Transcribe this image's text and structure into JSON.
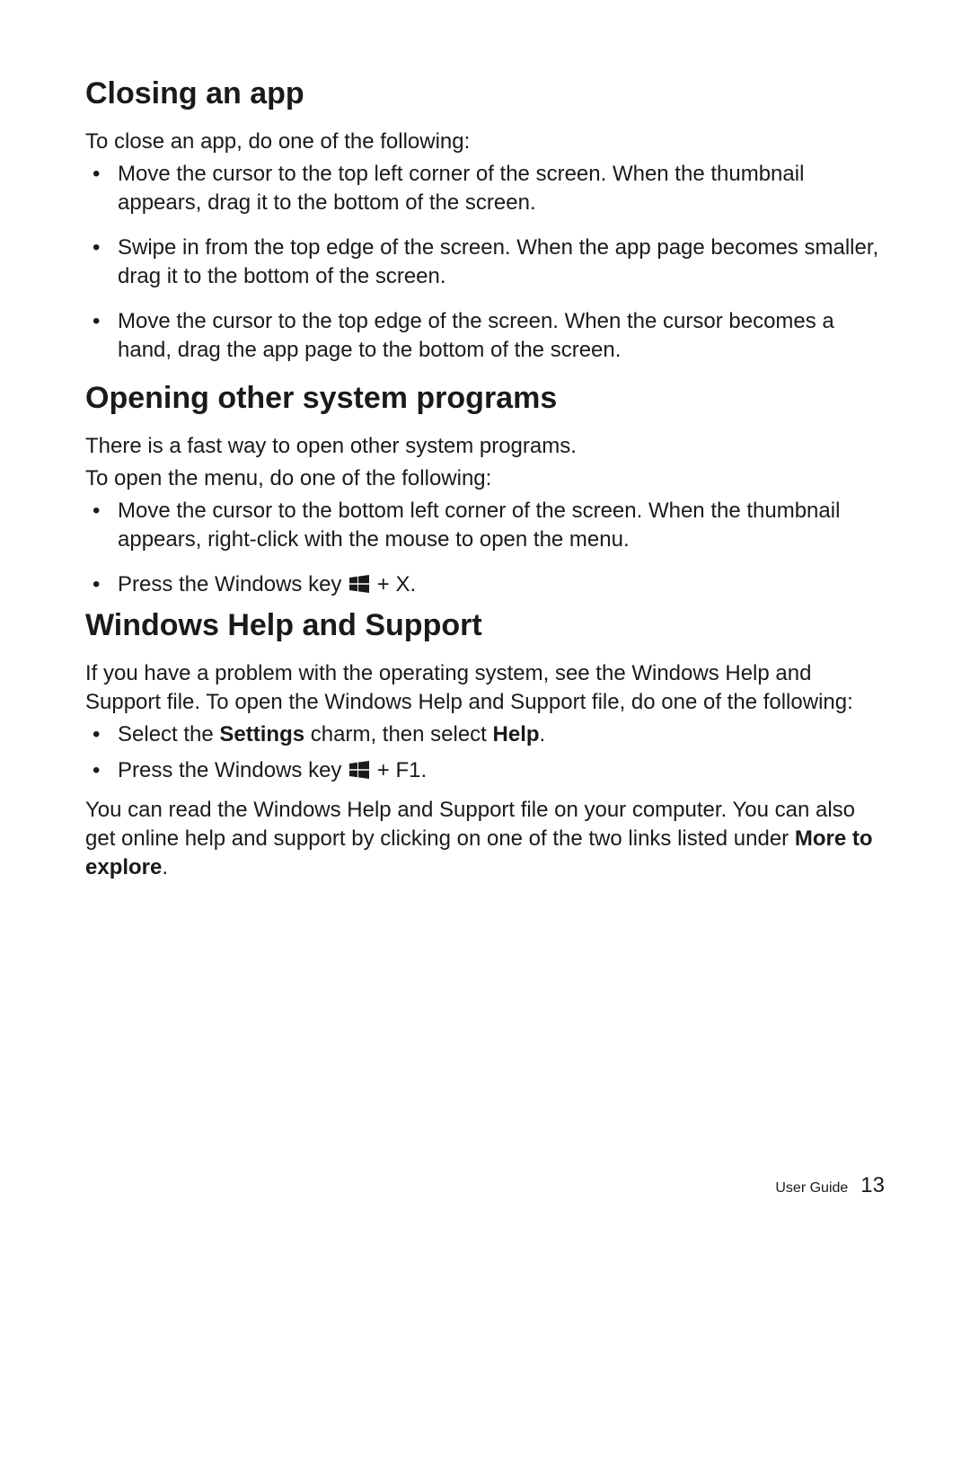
{
  "sections": {
    "closing": {
      "title": "Closing an app",
      "intro": "To close an app, do one of the following:",
      "bullets": [
        "Move the cursor to the top left corner of the screen. When the thumbnail appears, drag it to the bottom of the screen.",
        "Swipe in from the top edge of the screen. When the app page becomes smaller, drag it to the bottom of the screen.",
        "Move the cursor to the top edge of the screen. When the cursor becomes a hand, drag the app page to the bottom of the screen."
      ]
    },
    "opening": {
      "title": "Opening other system programs",
      "intro1": "There is a fast way to open other system programs.",
      "intro2": "To open the menu, do one of the following:",
      "bullets": {
        "b1": "Move the cursor to the bottom left corner of the screen. When the thumbnail appears, right-click with the mouse to open the menu.",
        "b2_pre": "Press the Windows key ",
        "b2_post": " + X."
      }
    },
    "help": {
      "title": "Windows Help and Support",
      "intro": "If you have a problem with the operating system, see the Windows Help and Support file. To open the Windows Help and Support file, do one of the following:",
      "bullets": {
        "b1_pre": "Select the ",
        "b1_bold1": "Settings",
        "b1_mid": " charm, then select ",
        "b1_bold2": "Help",
        "b1_post": ".",
        "b2_pre": "Press the Windows key ",
        "b2_post": " + F1."
      },
      "outro_pre": "You can read the Windows Help and Support file on your computer. You can also get online help and support by clicking on one of the two links listed under ",
      "outro_bold": "More to explore",
      "outro_post": "."
    }
  },
  "footer": {
    "label": "User Guide",
    "page": "13"
  }
}
